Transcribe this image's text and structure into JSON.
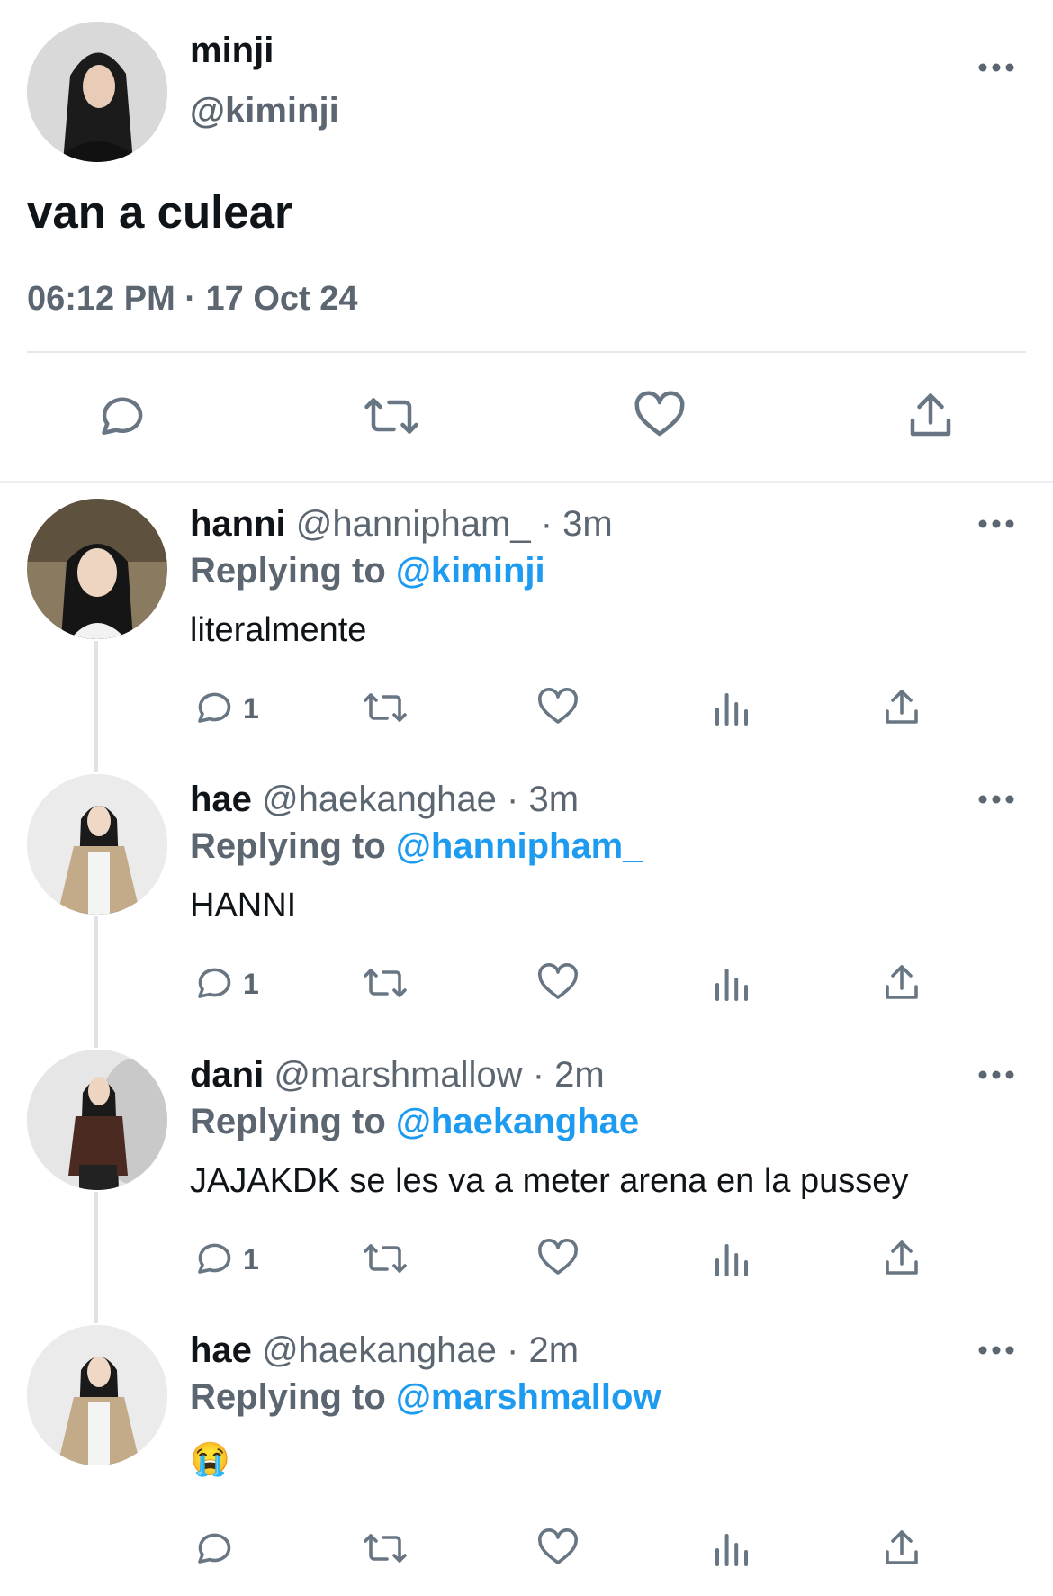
{
  "main_tweet": {
    "display_name": "minji",
    "handle": "@kiminji",
    "text": "van a culear",
    "timestamp": "06:12 PM · 17 Oct 24"
  },
  "replies": [
    {
      "display_name": "hanni",
      "handle": "@hannipham_",
      "time": "· 3m",
      "replying_label": "Replying to",
      "replying_to": "@kiminji",
      "text": "literalmente",
      "reply_count": "1"
    },
    {
      "display_name": "hae",
      "handle": "@haekanghae",
      "time": "· 3m",
      "replying_label": "Replying to",
      "replying_to": "@hannipham_",
      "text": "HANNI",
      "reply_count": "1"
    },
    {
      "display_name": "dani",
      "handle": "@marshmallow",
      "time": "· 2m",
      "replying_label": "Replying to",
      "replying_to": "@haekanghae",
      "text": "JAJAKDK se les va a meter arena en la pussey",
      "reply_count": "1"
    },
    {
      "display_name": "hae",
      "handle": "@haekanghae",
      "time": "· 2m",
      "replying_label": "Replying to",
      "replying_to": "@marshmallow",
      "text": "😭",
      "reply_count": ""
    }
  ],
  "icons": [
    "reply-icon",
    "retweet-icon",
    "like-icon",
    "views-icon",
    "share-icon",
    "more-icon"
  ],
  "colors": {
    "link": "#1d9bf0",
    "secondary": "#5b6671",
    "icon": "#687684"
  }
}
